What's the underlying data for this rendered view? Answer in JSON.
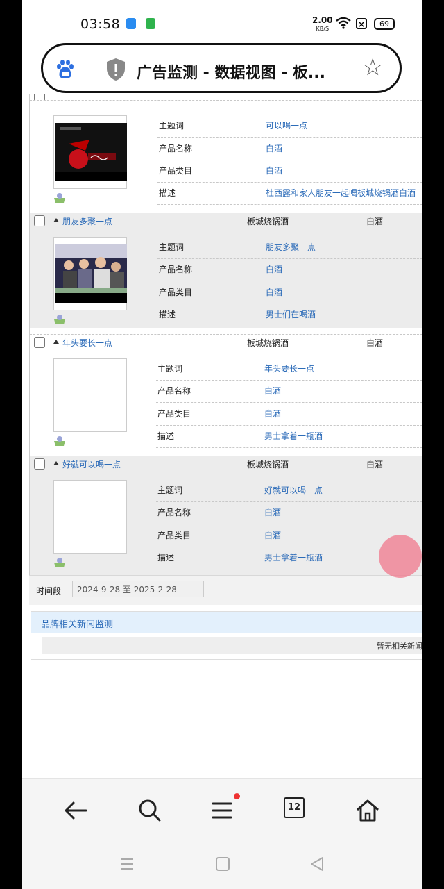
{
  "status_bar": {
    "time": "03:58",
    "net_speed_value": "2.00",
    "net_speed_unit": "KB/S",
    "battery": "69"
  },
  "address_bar": {
    "page_title": "广告监测 - 数据视图 - 板..."
  },
  "ads": [
    {
      "title": "",
      "brand": "",
      "category": "",
      "fields": [
        {
          "label": "主题词",
          "value": "可以喝一点"
        },
        {
          "label": "产品名称",
          "value": "白酒"
        },
        {
          "label": "产品类目",
          "value": "白酒"
        },
        {
          "label": "描述",
          "value": "杜西露和家人朋友一起喝板城烧锅酒白酒"
        }
      ]
    },
    {
      "title": "朋友多聚一点",
      "brand": "板城烧锅酒",
      "category": "白酒",
      "fields": [
        {
          "label": "主题词",
          "value": "朋友多聚一点"
        },
        {
          "label": "产品名称",
          "value": "白酒"
        },
        {
          "label": "产品类目",
          "value": "白酒"
        },
        {
          "label": "描述",
          "value": "男士们在喝酒"
        }
      ]
    },
    {
      "title": "年头要长一点",
      "brand": "板城烧锅酒",
      "category": "白酒",
      "fields": [
        {
          "label": "主题词",
          "value": "年头要长一点"
        },
        {
          "label": "产品名称",
          "value": "白酒"
        },
        {
          "label": "产品类目",
          "value": "白酒"
        },
        {
          "label": "描述",
          "value": "男士拿着一瓶酒"
        }
      ]
    },
    {
      "title": "好就可以喝一点",
      "brand": "板城烧锅酒",
      "category": "白酒",
      "fields": [
        {
          "label": "主题词",
          "value": "好就可以喝一点"
        },
        {
          "label": "产品名称",
          "value": "白酒"
        },
        {
          "label": "产品类目",
          "value": "白酒"
        },
        {
          "label": "描述",
          "value": "男士拿着一瓶酒"
        }
      ]
    }
  ],
  "period": {
    "label": "时间段",
    "value": "2024-9-28 至 2025-2-28"
  },
  "news": {
    "title": "品牌相关新闻监测",
    "empty_text": "暂无相关新闻"
  },
  "toolbar": {
    "tabs_count": "12"
  }
}
